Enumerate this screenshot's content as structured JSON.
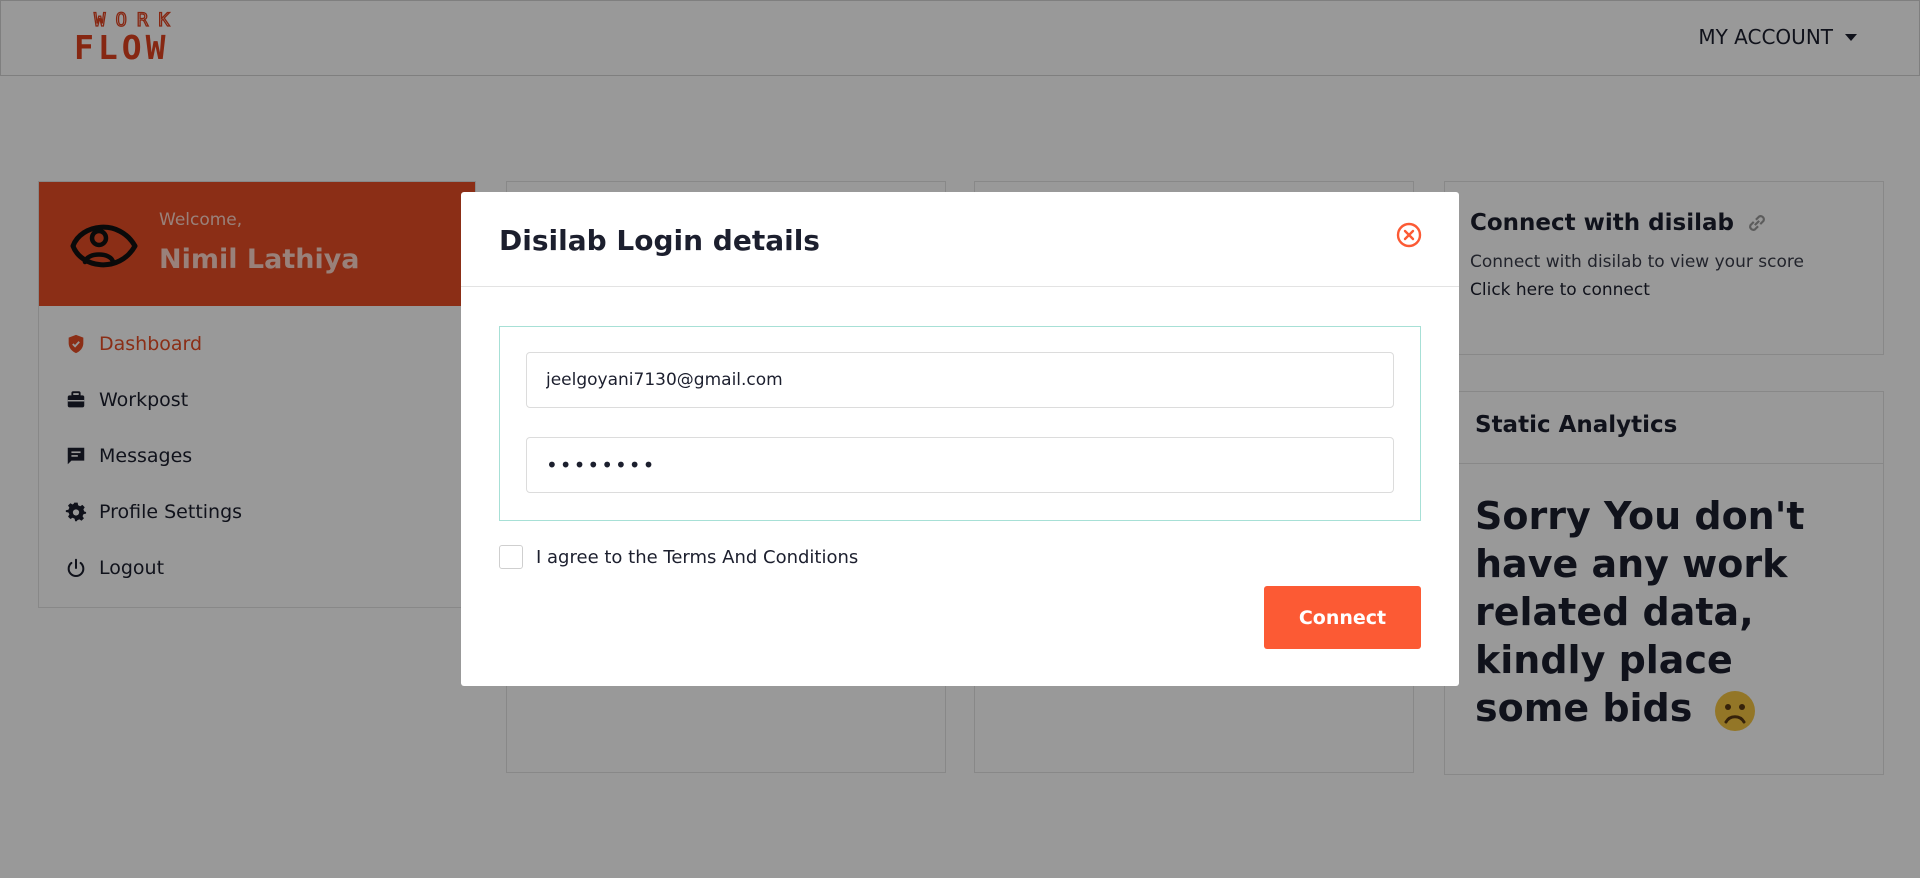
{
  "header": {
    "logo_top": "WORK",
    "logo_bottom": "FLOW",
    "account_label": "MY ACCOUNT"
  },
  "sidebar": {
    "welcome": "Welcome,",
    "user_name": "Nimil Lathiya",
    "items": [
      {
        "label": "Dashboard",
        "icon": "shield-check-icon",
        "active": true
      },
      {
        "label": "Workpost",
        "icon": "briefcase-icon"
      },
      {
        "label": "Messages",
        "icon": "message-icon"
      },
      {
        "label": "Profile Settings",
        "icon": "gear-icon"
      },
      {
        "label": "Logout",
        "icon": "power-icon"
      }
    ]
  },
  "connect_card": {
    "title": "Connect with disilab",
    "subtitle": "Connect with disilab to view your score",
    "link": "Click here to connect"
  },
  "stats_card": {
    "title": "Static Analytics",
    "message": "Sorry You don't have any work related data, kindly place some bids"
  },
  "modal": {
    "title": "Disilab Login details",
    "email_value": "jeelgoyani7130@gmail.com",
    "password_value": "••••••••",
    "agree_label": "I agree to the Terms And Conditions",
    "connect_label": "Connect"
  },
  "colors": {
    "brand": "#e84d25",
    "button": "#fc5a34",
    "field_box_border": "#a7e0d6"
  }
}
